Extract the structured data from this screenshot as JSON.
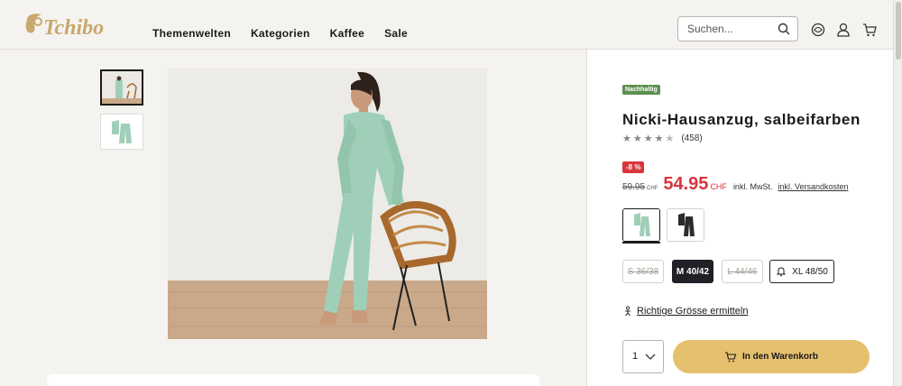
{
  "brand": {
    "name": "Tchibo",
    "color": "#c8a86b"
  },
  "nav": {
    "items": [
      "Themenwelten",
      "Kategorien",
      "Kaffee",
      "Sale"
    ]
  },
  "search": {
    "placeholder": "Suchen..."
  },
  "header_icons": [
    "service-icon",
    "account-icon",
    "cart-icon"
  ],
  "product": {
    "badge": "Nachhaltig",
    "title": "Nicki-Hausanzug, salbeifarben",
    "rating": {
      "value": 3.5,
      "max": 5,
      "count_label": "(458)"
    },
    "discount_badge": "-8 %",
    "old_price": "59.95",
    "old_currency": "CHF",
    "new_price": "54.95",
    "new_currency": "CHF",
    "vat_note": "inkl. MwSt.",
    "shipping_link": "inkl. Versandkosten",
    "colors": [
      "salbei",
      "schwarz"
    ],
    "sizes": [
      {
        "label": "S 36/38",
        "state": "unavailable"
      },
      {
        "label": "M 40/42",
        "state": "selected"
      },
      {
        "label": "L 44/46",
        "state": "unavailable"
      },
      {
        "label": "XL 48/50",
        "state": "notify"
      }
    ],
    "fit_link": "Richtige Grösse ermitteln",
    "quantity": "1",
    "cart_button": "In den Warenkorb"
  },
  "colors": {
    "sale_red": "#d9363e",
    "badge_green": "#5d8f50",
    "cart_yellow": "#e5c06e",
    "selected_dark": "#1f2126"
  }
}
